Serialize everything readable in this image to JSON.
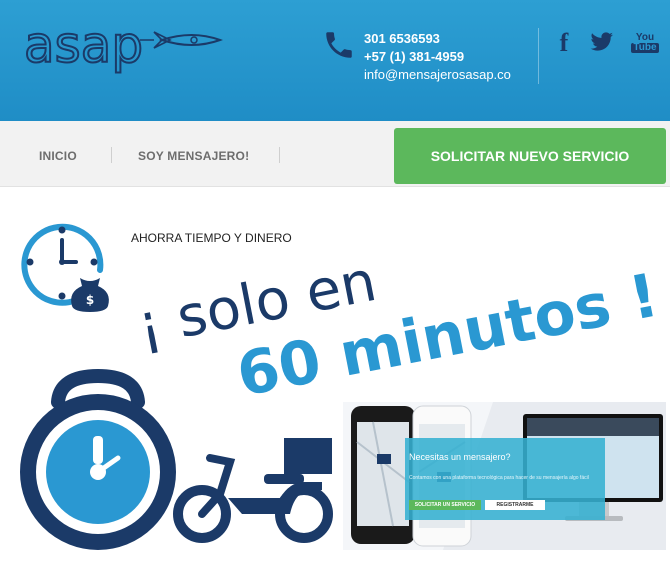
{
  "header": {
    "logo_text": "asap",
    "phone_1": "301 6536593",
    "phone_2": "+57 (1) 381-4959",
    "email": "info@mensajerosasap.co",
    "social": {
      "facebook_glyph": "f",
      "youtube_top": "You",
      "youtube_bottom": "Tube"
    }
  },
  "nav": {
    "items": [
      {
        "label": "INICIO"
      },
      {
        "label": "SOY MENSAJERO!"
      }
    ],
    "cta_label": "SOLICITAR NUEVO SERVICIO"
  },
  "hero": {
    "tagline": "AHORRA TIEMPO Y DINERO",
    "headline_1": "¡ solo en",
    "headline_2": "60 minutos !"
  },
  "promo": {
    "title": "Necesitas un mensajero?",
    "subtitle": "Contamos con una plataforma tecnológica para hacer de su mensajería algo fácil",
    "button_primary": "SOLICITAR UN SERVICIO",
    "button_secondary": "REGISTRARME"
  },
  "colors": {
    "header_blue": "#1f8dc6",
    "navy": "#1b3a68",
    "cta_green": "#5cb85c",
    "accent_blue": "#2a98d2"
  },
  "icons": [
    "rocket-icon",
    "phone-icon",
    "facebook-icon",
    "twitter-icon",
    "youtube-icon",
    "clock-icon",
    "money-bag-icon",
    "stopwatch-icon",
    "moped-icon"
  ]
}
